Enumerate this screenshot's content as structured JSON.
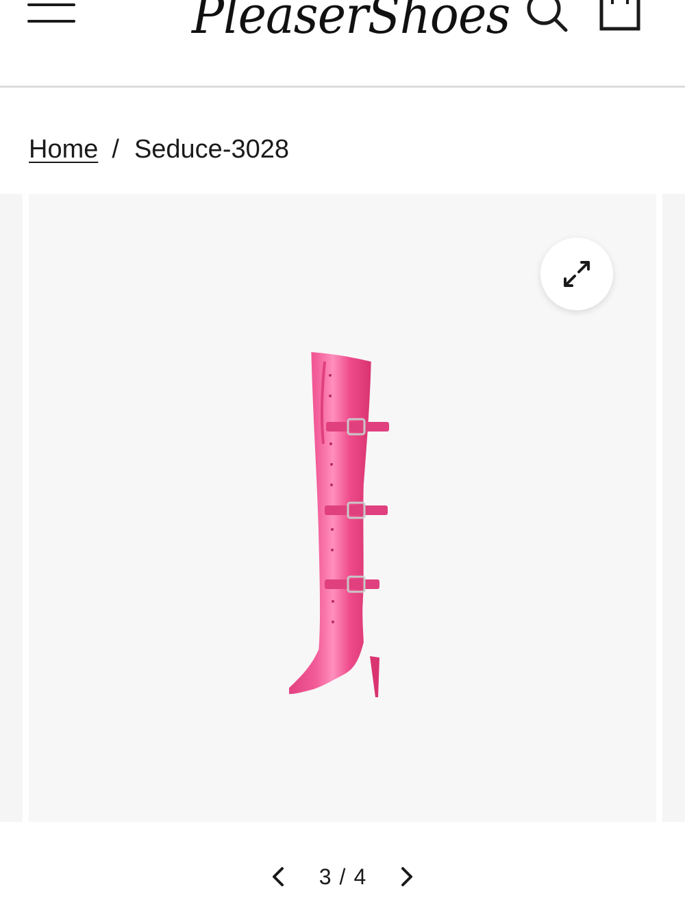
{
  "header": {
    "brand": "PleaserShoes",
    "menu_icon": "hamburger-menu-icon",
    "search_icon": "search-icon",
    "cart_icon": "shopping-bag-icon"
  },
  "breadcrumb": {
    "home": "Home",
    "separator": "/",
    "current": "Seduce-3028"
  },
  "gallery": {
    "zoom_icon": "expand-arrows-icon",
    "product_color": "#ee4b8c",
    "pagination": {
      "current": "3",
      "separator": "/",
      "total": "4",
      "prev_icon": "chevron-left-icon",
      "next_icon": "chevron-right-icon"
    }
  }
}
